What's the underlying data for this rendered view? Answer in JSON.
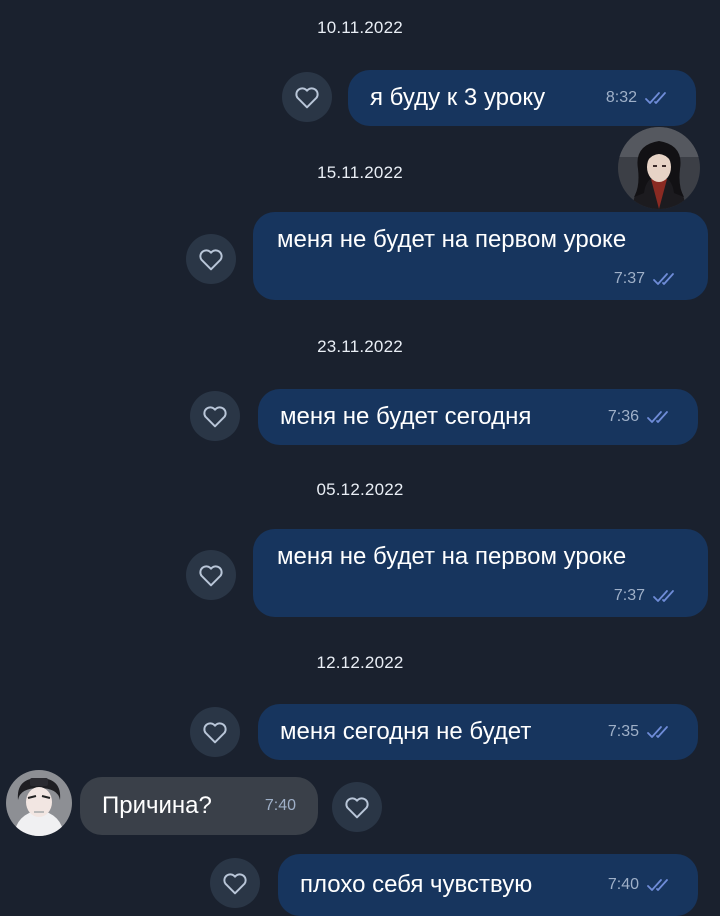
{
  "colors": {
    "background": "#1a212e",
    "outgoing_bubble": "#17355e",
    "incoming_bubble": "#3a4049",
    "heart_button": "#2a3646",
    "read_ticks": "#6f8cd8"
  },
  "messages": [
    {
      "date": "10.11.2022",
      "text": "я буду к 3 уроку",
      "time": "8:32",
      "direction": "outgoing",
      "status": "read"
    },
    {
      "date": "15.11.2022",
      "text": "меня не будет на первом уроке",
      "time": "7:37",
      "direction": "outgoing",
      "status": "read"
    },
    {
      "date": "23.11.2022",
      "text": "меня не будет сегодня",
      "time": "7:36",
      "direction": "outgoing",
      "status": "read"
    },
    {
      "date": "05.12.2022",
      "text": "меня не будет на первом уроке",
      "time": "7:37",
      "direction": "outgoing",
      "status": "read"
    },
    {
      "date": "12.12.2022",
      "text": "меня сегодня не будет",
      "time": "7:35",
      "direction": "outgoing",
      "status": "read"
    },
    {
      "date": "",
      "text": "Причина?",
      "time": "7:40",
      "direction": "incoming",
      "status": ""
    },
    {
      "date": "",
      "text": "плохо себя чувствую",
      "time": "7:40",
      "direction": "outgoing",
      "status": "read"
    }
  ],
  "icons": {
    "like": "heart-icon",
    "read_status": "double-check-icon"
  }
}
